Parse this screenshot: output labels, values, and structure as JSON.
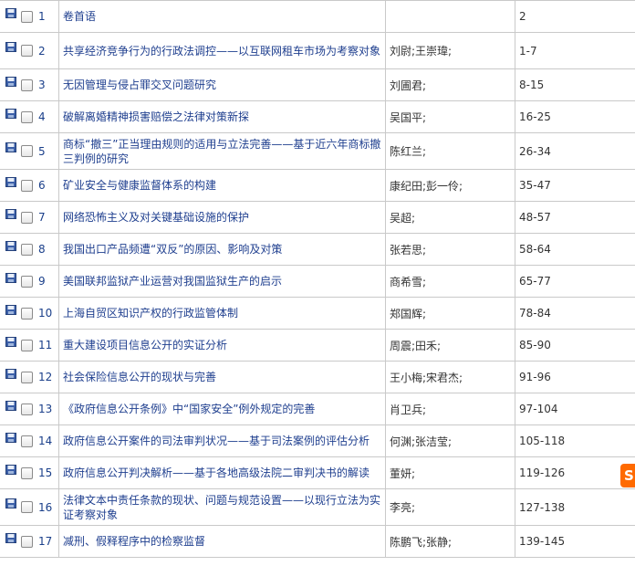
{
  "rows": [
    {
      "num": "1",
      "title": "卷首语",
      "author": "",
      "pages": "2"
    },
    {
      "num": "2",
      "title": "共享经济竞争行为的行政法调控——以互联网租车市场为考察对象",
      "author": "刘尉;王崇瑋;",
      "pages": "1-7"
    },
    {
      "num": "3",
      "title": "无因管理与侵占罪交叉问题研究",
      "author": "刘圃君;",
      "pages": "8-15"
    },
    {
      "num": "4",
      "title": "破解离婚精神损害赔偿之法律对策新探",
      "author": "吴国平;",
      "pages": "16-25"
    },
    {
      "num": "5",
      "title": "商标“撤三”正当理由规则的适用与立法完善——基于近六年商标撤三判例的研究",
      "author": "陈红兰;",
      "pages": "26-34"
    },
    {
      "num": "6",
      "title": "矿业安全与健康监督体系的构建",
      "author": "康纪田;彭一伶;",
      "pages": "35-47"
    },
    {
      "num": "7",
      "title": "网络恐怖主义及对关键基础设施的保护",
      "author": "吴超;",
      "pages": "48-57"
    },
    {
      "num": "8",
      "title": "我国出口产品频遭“双反”的原因、影响及对策",
      "author": "张若思;",
      "pages": "58-64"
    },
    {
      "num": "9",
      "title": "美国联邦监狱产业运营对我国监狱生产的启示",
      "author": "商希雪;",
      "pages": "65-77"
    },
    {
      "num": "10",
      "title": "上海自贸区知识产权的行政监管体制",
      "author": "郑国辉;",
      "pages": "78-84"
    },
    {
      "num": "11",
      "title": "重大建设项目信息公开的实证分析",
      "author": "周震;田禾;",
      "pages": "85-90"
    },
    {
      "num": "12",
      "title": "社会保险信息公开的现状与完善",
      "author": "王小梅;宋君杰;",
      "pages": "91-96"
    },
    {
      "num": "13",
      "title": "《政府信息公开条例》中“国家安全”例外规定的完善",
      "author": "肖卫兵;",
      "pages": "97-104"
    },
    {
      "num": "14",
      "title": "政府信息公开案件的司法审判状况——基于司法案例的评估分析",
      "author": "何渊;张洁莹;",
      "pages": "105-118"
    },
    {
      "num": "15",
      "title": "政府信息公开判决解析——基于各地高级法院二审判决书的解读",
      "author": "董妍;",
      "pages": "119-126"
    },
    {
      "num": "16",
      "title": "法律文本中责任条款的现状、问题与规范设置——以现行立法为实证考察对象",
      "author": "李亮;",
      "pages": "127-138"
    },
    {
      "num": "17",
      "title": "减刑、假释程序中的检察监督",
      "author": "陈鹏飞;张静;",
      "pages": "139-145"
    }
  ],
  "badge": {
    "label": "S"
  }
}
